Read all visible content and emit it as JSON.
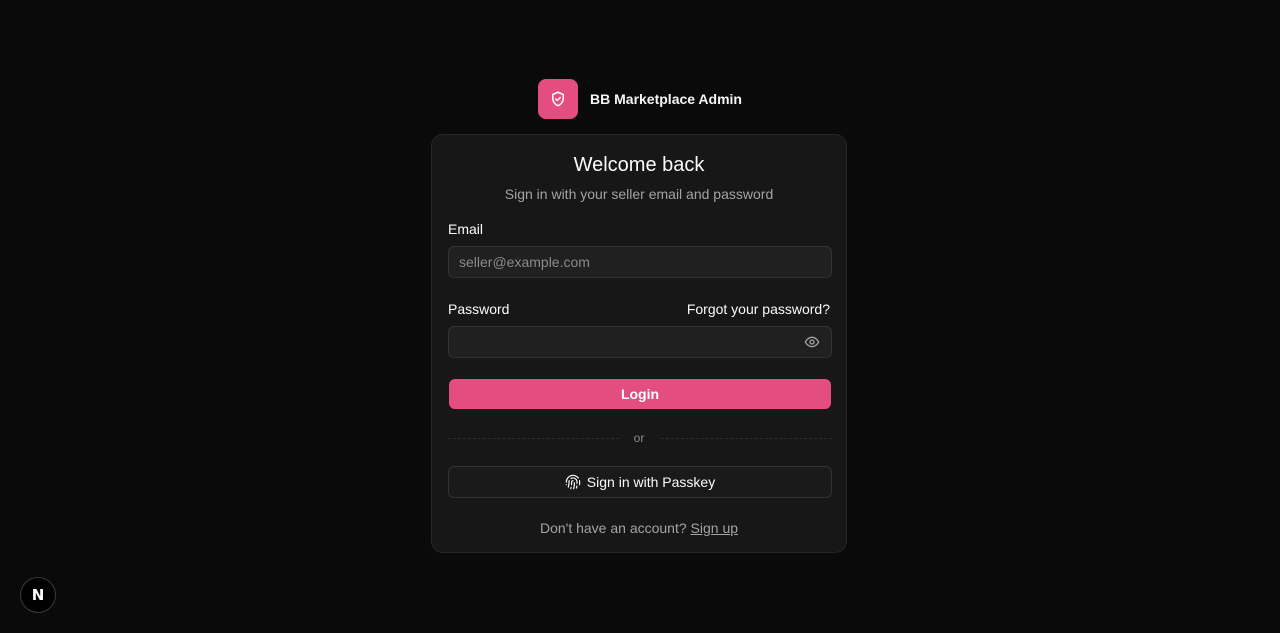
{
  "brand": {
    "name": "BB Marketplace Admin",
    "logo_icon": "shield-check-icon",
    "accent_color": "#e44d7f"
  },
  "card": {
    "title": "Welcome back",
    "subtitle": "Sign in with your seller email and password"
  },
  "form": {
    "email_label": "Email",
    "email_placeholder": "seller@example.com",
    "email_value": "",
    "password_label": "Password",
    "password_value": "",
    "forgot_link": "Forgot your password?",
    "toggle_visibility_icon": "eye-icon",
    "login_label": "Login"
  },
  "divider": {
    "text": "or"
  },
  "passkey": {
    "label": "Sign in with Passkey",
    "icon": "fingerprint-icon"
  },
  "signup": {
    "prompt": "Don't have an account?",
    "link": "Sign up"
  },
  "dev_badge": {
    "letter": "N",
    "icon": "nextjs-icon"
  }
}
